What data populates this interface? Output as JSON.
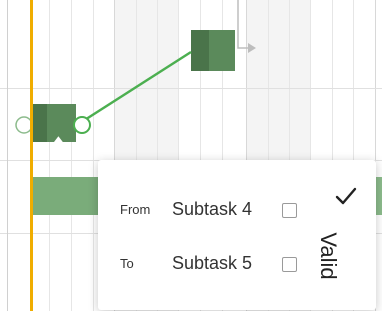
{
  "dependency_dialog": {
    "from_label": "From",
    "from_value": "Subtask 4",
    "to_label": "To",
    "to_value": "Subtask 5",
    "status_text": "Valid",
    "status_icon": "checkmark-icon"
  },
  "colors": {
    "today_marker": "#f0ad00",
    "task_bar": "#5b8a5b",
    "connector": "#4caf50"
  }
}
